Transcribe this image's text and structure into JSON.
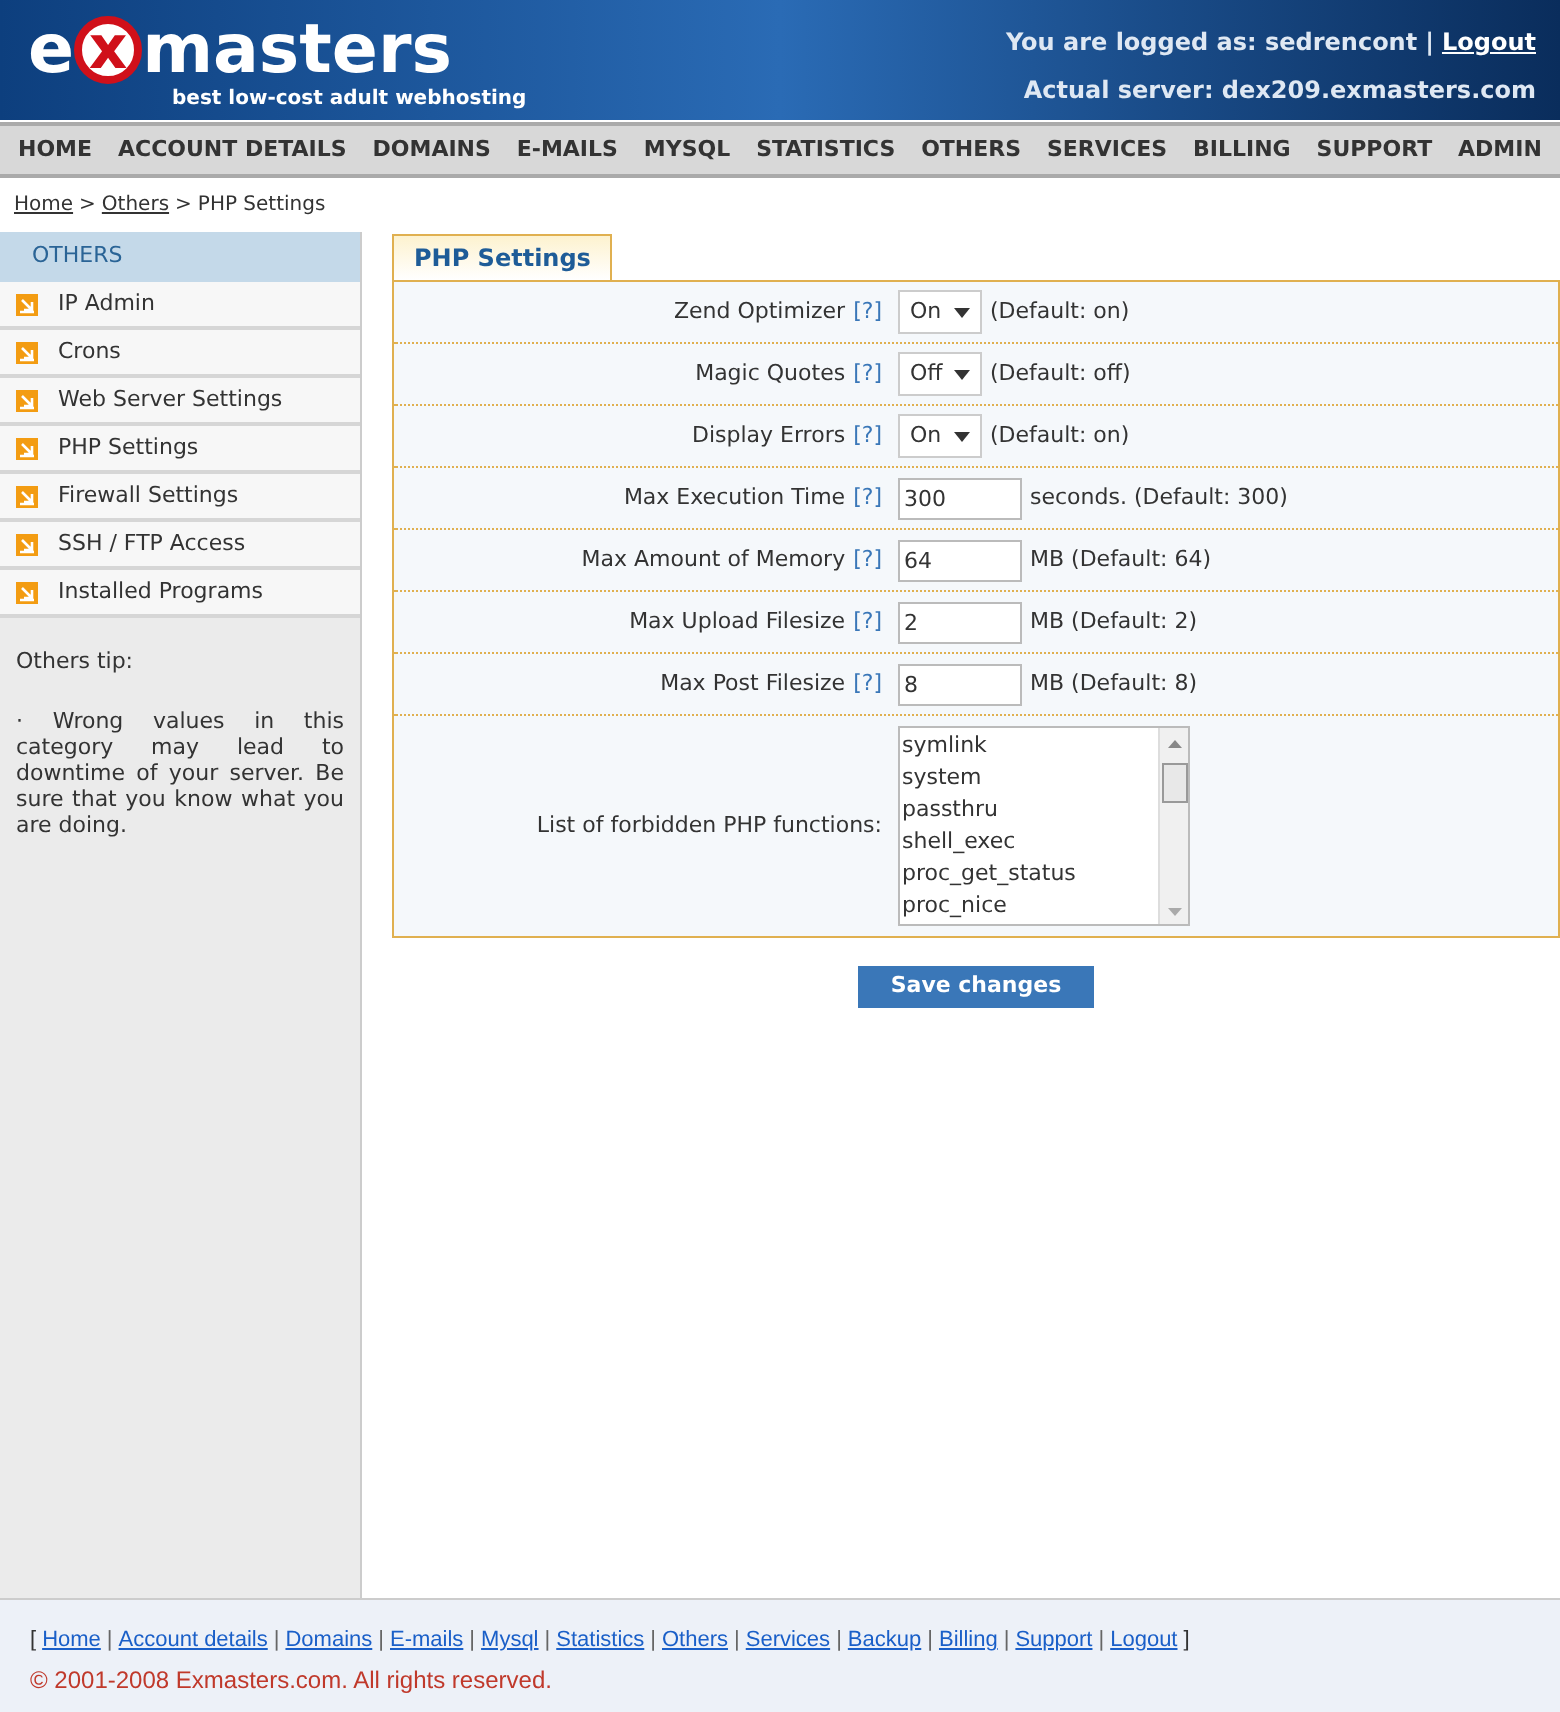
{
  "header": {
    "logo": {
      "prefix": "e",
      "mark": "x",
      "name": "masters",
      "tagline": "best low-cost adult webhosting"
    },
    "logged_as": "You are logged as: sedrencont",
    "separator": "|",
    "logout": "Logout",
    "server": "Actual server: dex209.exmasters.com"
  },
  "nav": [
    "HOME",
    "ACCOUNT DETAILS",
    "DOMAINS",
    "E-MAILS",
    "MYSQL",
    "STATISTICS",
    "OTHERS",
    "SERVICES",
    "BILLING",
    "SUPPORT",
    "ADMIN"
  ],
  "breadcrumb": {
    "links": [
      "Home",
      "Others"
    ],
    "separator": ">",
    "current": "PHP Settings"
  },
  "sidebar": {
    "title": "OTHERS",
    "items": [
      "IP Admin",
      "Crons",
      "Web Server Settings",
      "PHP Settings",
      "Firewall Settings",
      "SSH / FTP Access",
      "Installed Programs"
    ],
    "tip_title": "Others tip:",
    "tip": "· Wrong values in this category may lead to downtime of your server. Be sure that you know what you are doing."
  },
  "panel": {
    "tab": "PHP Settings",
    "rows": [
      {
        "kind": "select",
        "label": "Zend Optimizer",
        "help": "[?]",
        "value": "On",
        "note": "(Default: on)"
      },
      {
        "kind": "select",
        "label": "Magic Quotes",
        "help": "[?]",
        "value": "Off",
        "note": "(Default: off)"
      },
      {
        "kind": "select",
        "label": "Display Errors",
        "help": "[?]",
        "value": "On",
        "note": "(Default: on)"
      },
      {
        "kind": "text",
        "label": "Max Execution Time",
        "help": "[?]",
        "value": "300",
        "note": "seconds. (Default: 300)"
      },
      {
        "kind": "text",
        "label": "Max Amount of Memory",
        "help": "[?]",
        "value": "64",
        "note": "MB (Default: 64)"
      },
      {
        "kind": "text",
        "label": "Max Upload Filesize",
        "help": "[?]",
        "value": "2",
        "note": "MB (Default: 2)"
      },
      {
        "kind": "text",
        "label": "Max Post Filesize",
        "help": "[?]",
        "value": "8",
        "note": "MB (Default: 8)"
      },
      {
        "kind": "list",
        "label": "List of forbidden PHP functions:",
        "options": [
          "symlink",
          "system",
          "passthru",
          "shell_exec",
          "proc_get_status",
          "proc_nice"
        ]
      }
    ],
    "button": "Save changes"
  },
  "footer": {
    "open": "[",
    "links": [
      "Home",
      "Account details",
      "Domains",
      "E-mails",
      "Mysql",
      "Statistics",
      "Others",
      "Services",
      "Backup",
      "Billing",
      "Support",
      "Logout"
    ],
    "separator": "|",
    "close": "]",
    "copyright": "© 2001-2008 Exmasters.com. All rights reserved."
  }
}
